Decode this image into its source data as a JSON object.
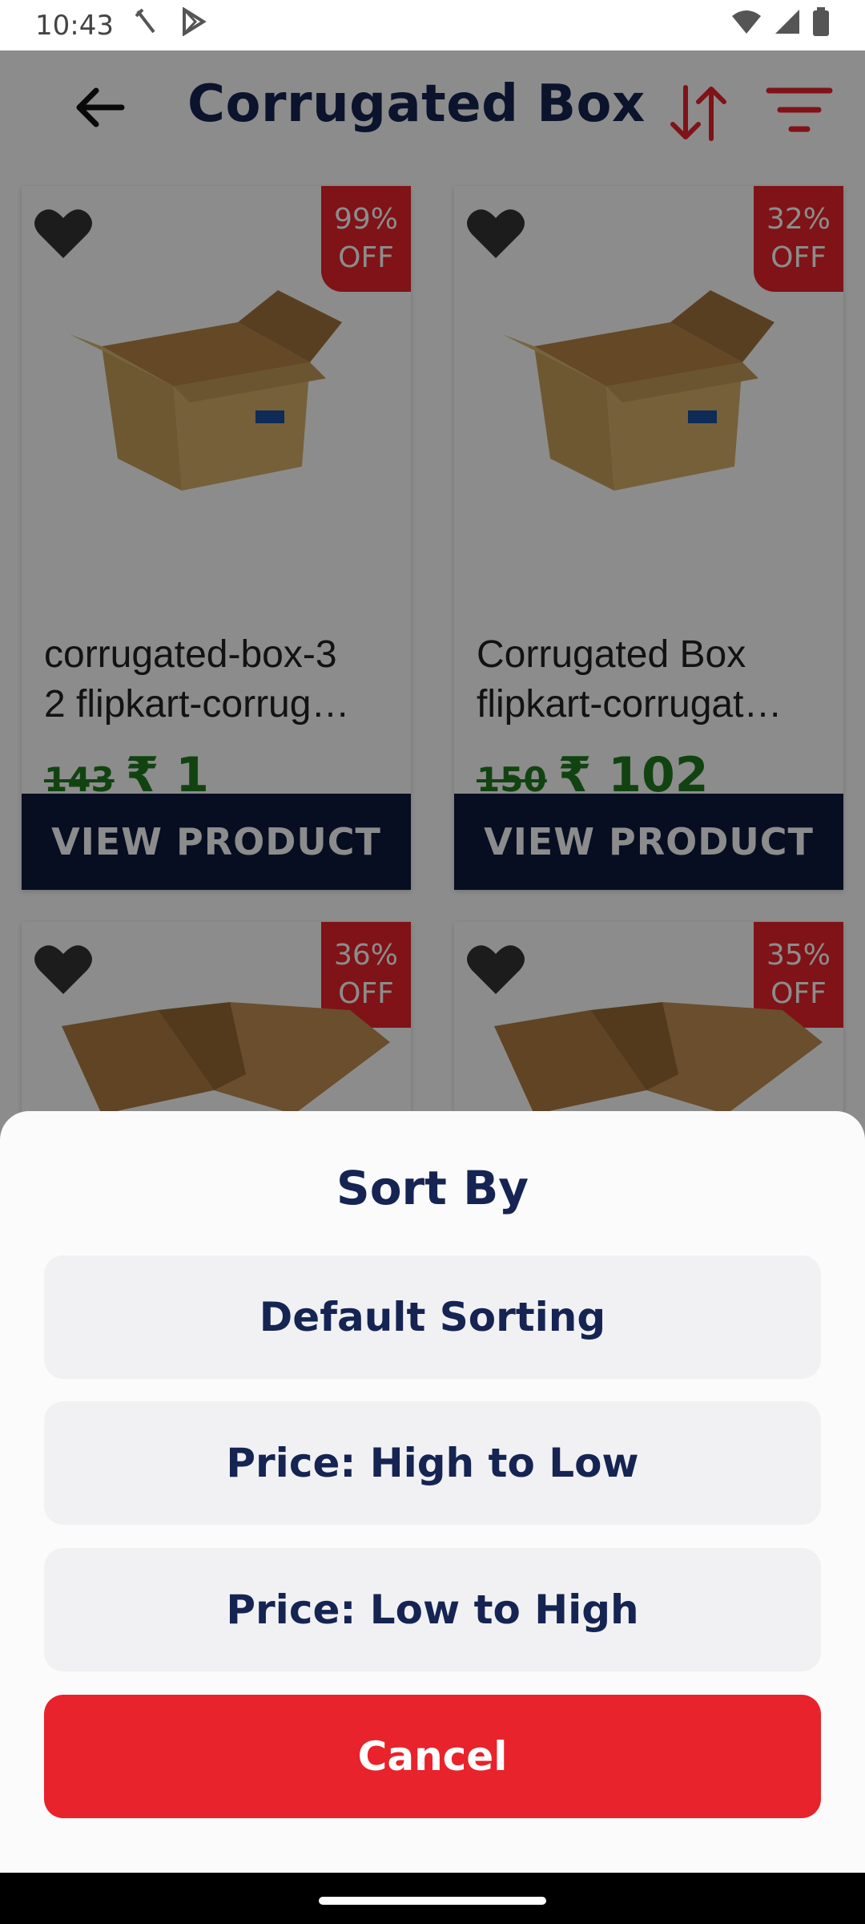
{
  "status_bar": {
    "time": "10:43",
    "icons": [
      "tools-icon",
      "play-store-icon",
      "wifi-icon",
      "signal-icon",
      "battery-icon"
    ]
  },
  "app_bar": {
    "title": "Corrugated Box",
    "icons": [
      "back-arrow-icon",
      "sort-arrows-icon",
      "filter-icon"
    ],
    "accent_color": "#e8232b"
  },
  "products": [
    {
      "name": "corrugated-box-3\n2 flipkart-corrug…",
      "discount": "99%\nOFF",
      "old_price": "143",
      "price": "₹ 1",
      "button": "VIEW PRODUCT"
    },
    {
      "name": "Corrugated Box\nflipkart-corrugat…",
      "discount": "32%\nOFF",
      "old_price": "150",
      "price": "₹ 102",
      "button": "VIEW PRODUCT"
    },
    {
      "discount": "36%\nOFF"
    },
    {
      "discount": "35%\nOFF"
    }
  ],
  "sort_sheet": {
    "title": "Sort By",
    "options": [
      "Default Sorting",
      "Price: High to Low",
      "Price: Low to High"
    ],
    "cancel": "Cancel"
  },
  "colors": {
    "navy": "#152452",
    "button_dark": "#0d1b3e",
    "price_green": "#1f7a1f",
    "badge_red": "#e8232b"
  }
}
